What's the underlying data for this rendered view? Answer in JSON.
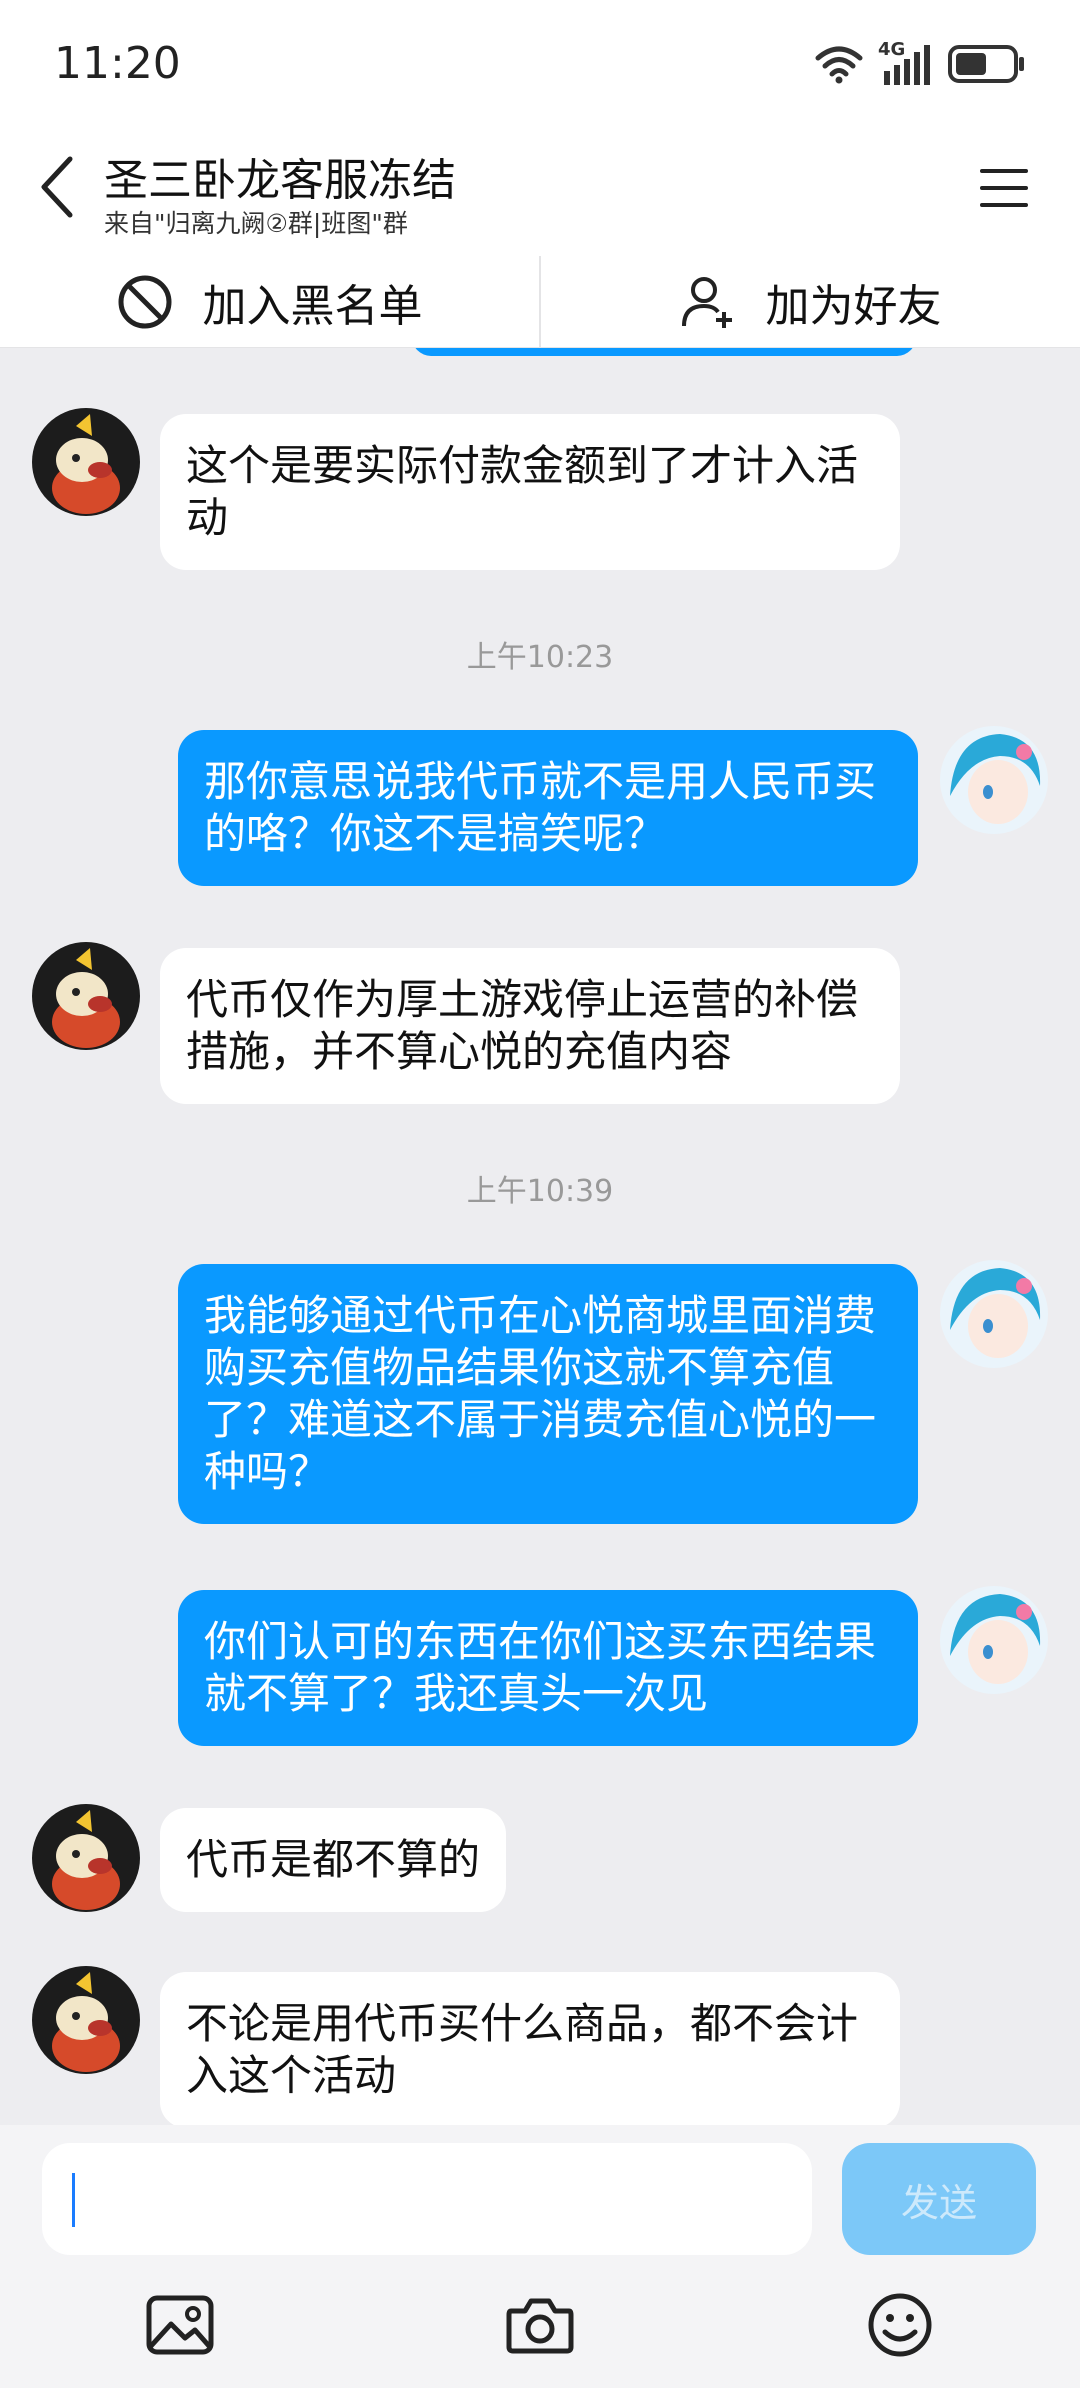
{
  "status_bar": {
    "time": "11:20",
    "network": "4G"
  },
  "header": {
    "title": "圣三卧龙客服冻结",
    "subtitle": "来自\"归离九阙②群|班图\"群",
    "block_label": "加入黑名单",
    "add_friend_label": "加为好友"
  },
  "messages": {
    "m1": "这个是要实际付款金额到了才计入活动",
    "ts1": "上午10:23",
    "m2": "那你意思说我代币就不是用人民币买的咯？你这不是搞笑呢？",
    "m3": "代币仅作为厚土游戏停止运营的补偿措施，并不算心悦的充值内容",
    "ts2": "上午10:39",
    "m4": "我能够通过代币在心悦商城里面消费购买充值物品结果你这就不算充值了？难道这不属于消费充值心悦的一种吗？",
    "m5": "你们认可的东西在你们这买东西结果就不算了？我还真头一次见",
    "m6": "代币是都不算的",
    "m7": "不论是用代币买什么商品，都不会计入这个活动"
  },
  "input": {
    "placeholder": "",
    "send_label": "发送"
  },
  "colors": {
    "accent": "#0a99ff",
    "send_disabled": "#7cc8f8",
    "chat_bg": "#ededf0"
  },
  "icons": [
    "back-arrow-icon",
    "menu-icon",
    "block-icon",
    "add-user-icon",
    "image-icon",
    "camera-icon",
    "emoji-icon",
    "wifi-icon",
    "signal-icon",
    "battery-icon"
  ]
}
